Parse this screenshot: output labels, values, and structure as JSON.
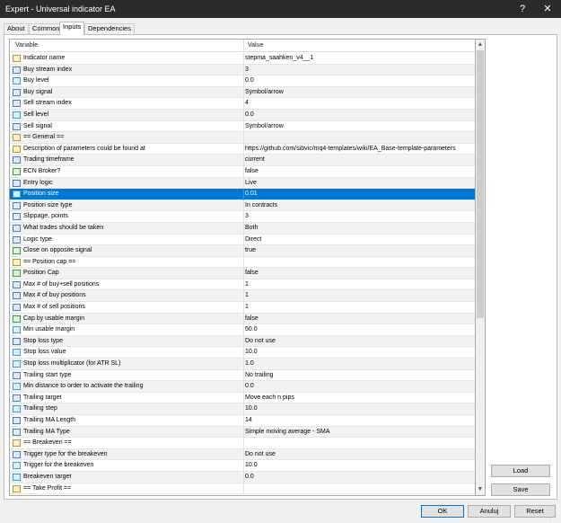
{
  "window": {
    "title": "Expert - Universal indicator EA",
    "help_label": "?",
    "close_label": "✕"
  },
  "tabs": [
    {
      "label": "About",
      "active": false
    },
    {
      "label": "Common",
      "active": false
    },
    {
      "label": "Inputs",
      "active": true
    },
    {
      "label": "Dependencies",
      "active": false
    }
  ],
  "grid": {
    "columns": {
      "variable": "Variable",
      "value": "Value"
    },
    "rows": [
      {
        "icon": "abc",
        "name": "Indicator name",
        "value": "stepma_saahken_v4__1"
      },
      {
        "icon": "123",
        "name": "Buy stream index",
        "value": "3"
      },
      {
        "icon": "1/2",
        "name": "Buy level",
        "value": "0.0"
      },
      {
        "icon": "123",
        "name": "Buy signal",
        "value": "Symbol/arrow"
      },
      {
        "icon": "123",
        "name": "Sell stream index",
        "value": "4"
      },
      {
        "icon": "1/2",
        "name": "Sell level",
        "value": "0.0"
      },
      {
        "icon": "123",
        "name": "Sell signal",
        "value": "Symbol/arrow"
      },
      {
        "icon": "abc",
        "name": "== General ==",
        "value": ""
      },
      {
        "icon": "abc",
        "name": "Description of parameters could be found at",
        "value": "https://github.com/sibvic/mq4-templates/wiki/EA_Base-template-parameters"
      },
      {
        "icon": "123",
        "name": "Trading timeframe",
        "value": "current"
      },
      {
        "icon": "bool",
        "name": "ECN Broker?",
        "value": "false"
      },
      {
        "icon": "123",
        "name": "Entry logic",
        "value": "Live"
      },
      {
        "icon": "1/2",
        "name": "Position size",
        "value": "0.01",
        "selected": true
      },
      {
        "icon": "123",
        "name": "Position size type",
        "value": "In contracts"
      },
      {
        "icon": "123",
        "name": "Slippage, points",
        "value": "3"
      },
      {
        "icon": "123",
        "name": "What trades should be taken",
        "value": "Both"
      },
      {
        "icon": "123",
        "name": "Logic type",
        "value": "Direct"
      },
      {
        "icon": "bool",
        "name": "Close on opposite signal",
        "value": "true"
      },
      {
        "icon": "abc",
        "name": "== Position cap ==",
        "value": ""
      },
      {
        "icon": "bool",
        "name": "Position Cap",
        "value": "false"
      },
      {
        "icon": "123",
        "name": "Max # of buy+sell positions",
        "value": "1"
      },
      {
        "icon": "123",
        "name": "Max # of buy positions",
        "value": "1"
      },
      {
        "icon": "123",
        "name": "Max # of sell positions",
        "value": "1"
      },
      {
        "icon": "bool",
        "name": "Cap by usable margin",
        "value": "false"
      },
      {
        "icon": "1/2",
        "name": "Min usable margin",
        "value": "50.0"
      },
      {
        "icon": "123",
        "name": "Stop loss type",
        "value": "Do not use"
      },
      {
        "icon": "1/2",
        "name": "Stop loss value",
        "value": "10.0"
      },
      {
        "icon": "1/2",
        "name": "Stop loss multiplicator (for ATR SL)",
        "value": "1.0"
      },
      {
        "icon": "123",
        "name": "Trailing start type",
        "value": "No trailing"
      },
      {
        "icon": "1/2",
        "name": "Min distance to order to activate the trailing",
        "value": "0.0"
      },
      {
        "icon": "123",
        "name": "Trailing target",
        "value": "Move each n pips"
      },
      {
        "icon": "1/2",
        "name": "Trailing step",
        "value": "10.0"
      },
      {
        "icon": "123",
        "name": "Trailing MA Length",
        "value": "14"
      },
      {
        "icon": "123",
        "name": "Trailing MA Type",
        "value": "Simple moving average - SMA"
      },
      {
        "icon": "abc",
        "name": "== Breakeven ==",
        "value": ""
      },
      {
        "icon": "123",
        "name": "Trigger type for the breakeven",
        "value": "Do not use"
      },
      {
        "icon": "1/2",
        "name": "Trigger for the breakeven",
        "value": "10.0"
      },
      {
        "icon": "1/2",
        "name": "Breakeven target",
        "value": "0.0"
      },
      {
        "icon": "abc",
        "name": "== Take Profit ==",
        "value": ""
      }
    ]
  },
  "scrollbar": {
    "up_glyph": "▲",
    "down_glyph": "▼"
  },
  "side_buttons": {
    "load": "Load",
    "save": "Save"
  },
  "bottom_buttons": {
    "ok": "OK",
    "cancel": "Anuluj",
    "reset": "Reset"
  },
  "colors": {
    "selection": "#0078d7",
    "titlebar": "#2b2b2b"
  }
}
